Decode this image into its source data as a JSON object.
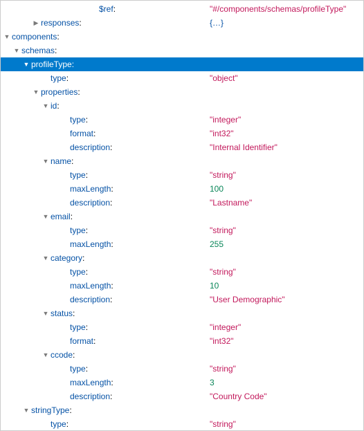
{
  "rows": [
    {
      "indent": 130,
      "arrow": "none",
      "key": "$ref",
      "valueType": "string",
      "value": "\"#/components/schemas/profileType\""
    },
    {
      "indent": 46,
      "arrow": "right",
      "key": "responses",
      "valueType": "default",
      "value": "{…}"
    },
    {
      "indent": 4,
      "arrow": "down",
      "key": "components",
      "valueType": "",
      "value": ""
    },
    {
      "indent": 18,
      "arrow": "down",
      "key": "schemas",
      "valueType": "",
      "value": ""
    },
    {
      "indent": 32,
      "arrow": "down",
      "key": "profileType",
      "valueType": "",
      "value": "",
      "selected": true
    },
    {
      "indent": 60,
      "arrow": "none",
      "key": "type",
      "valueType": "string",
      "value": "\"object\""
    },
    {
      "indent": 46,
      "arrow": "down",
      "key": "properties",
      "valueType": "",
      "value": ""
    },
    {
      "indent": 60,
      "arrow": "down",
      "key": "id",
      "valueType": "",
      "value": ""
    },
    {
      "indent": 88,
      "arrow": "none",
      "key": "type",
      "valueType": "string",
      "value": "\"integer\""
    },
    {
      "indent": 88,
      "arrow": "none",
      "key": "format",
      "valueType": "string",
      "value": "\"int32\""
    },
    {
      "indent": 88,
      "arrow": "none",
      "key": "description",
      "valueType": "string",
      "value": "\"Internal Identifier\""
    },
    {
      "indent": 60,
      "arrow": "down",
      "key": "name",
      "valueType": "",
      "value": ""
    },
    {
      "indent": 88,
      "arrow": "none",
      "key": "type",
      "valueType": "string",
      "value": "\"string\""
    },
    {
      "indent": 88,
      "arrow": "none",
      "key": "maxLength",
      "valueType": "number",
      "value": "100"
    },
    {
      "indent": 88,
      "arrow": "none",
      "key": "description",
      "valueType": "string",
      "value": "\"Lastname\""
    },
    {
      "indent": 60,
      "arrow": "down",
      "key": "email",
      "valueType": "",
      "value": ""
    },
    {
      "indent": 88,
      "arrow": "none",
      "key": "type",
      "valueType": "string",
      "value": "\"string\""
    },
    {
      "indent": 88,
      "arrow": "none",
      "key": "maxLength",
      "valueType": "number",
      "value": "255"
    },
    {
      "indent": 60,
      "arrow": "down",
      "key": "category",
      "valueType": "",
      "value": ""
    },
    {
      "indent": 88,
      "arrow": "none",
      "key": "type",
      "valueType": "string",
      "value": "\"string\""
    },
    {
      "indent": 88,
      "arrow": "none",
      "key": "maxLength",
      "valueType": "number",
      "value": "10"
    },
    {
      "indent": 88,
      "arrow": "none",
      "key": "description",
      "valueType": "string",
      "value": "\"User Demographic\""
    },
    {
      "indent": 60,
      "arrow": "down",
      "key": "status",
      "valueType": "",
      "value": ""
    },
    {
      "indent": 88,
      "arrow": "none",
      "key": "type",
      "valueType": "string",
      "value": "\"integer\""
    },
    {
      "indent": 88,
      "arrow": "none",
      "key": "format",
      "valueType": "string",
      "value": "\"int32\""
    },
    {
      "indent": 60,
      "arrow": "down",
      "key": "ccode",
      "valueType": "",
      "value": ""
    },
    {
      "indent": 88,
      "arrow": "none",
      "key": "type",
      "valueType": "string",
      "value": "\"string\""
    },
    {
      "indent": 88,
      "arrow": "none",
      "key": "maxLength",
      "valueType": "number",
      "value": "3"
    },
    {
      "indent": 88,
      "arrow": "none",
      "key": "description",
      "valueType": "string",
      "value": "\"Country Code\""
    },
    {
      "indent": 32,
      "arrow": "down",
      "key": "stringType",
      "valueType": "",
      "value": ""
    },
    {
      "indent": 60,
      "arrow": "none",
      "key": "type",
      "valueType": "string",
      "value": "\"string\""
    }
  ]
}
